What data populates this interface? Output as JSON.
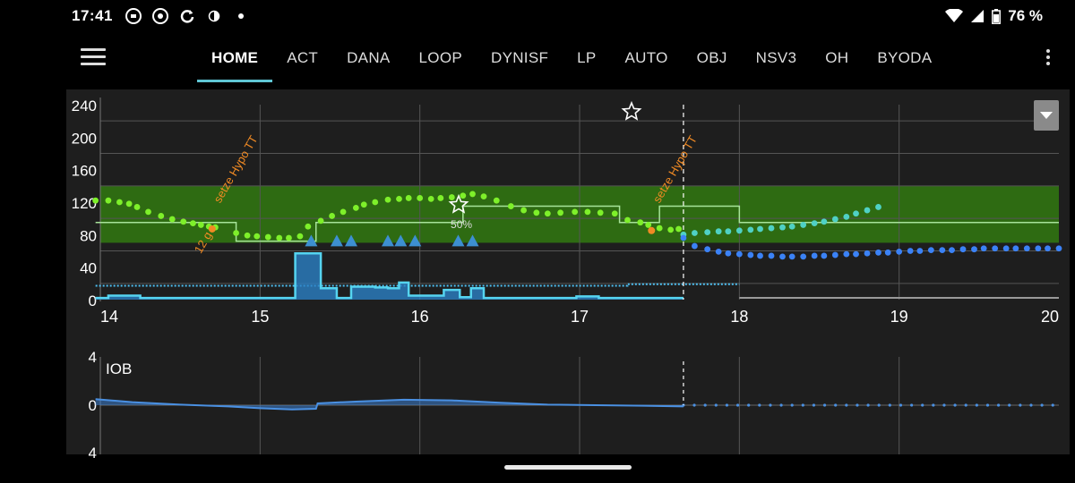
{
  "status": {
    "time": "17:41",
    "battery": "76 %",
    "left_icons": [
      "vpn-key-icon",
      "chrome-icon",
      "sync-icon",
      "contrast-icon",
      "dot-icon"
    ],
    "right_icons": [
      "wifi-icon",
      "signal-icon",
      "battery-icon"
    ]
  },
  "tabs": [
    {
      "label": "HOME",
      "active": true
    },
    {
      "label": "ACT"
    },
    {
      "label": "DANA"
    },
    {
      "label": "LOOP"
    },
    {
      "label": "DYNISF"
    },
    {
      "label": "LP"
    },
    {
      "label": "AUTO"
    },
    {
      "label": "OBJ"
    },
    {
      "label": "NSV3"
    },
    {
      "label": "OH"
    },
    {
      "label": "BYODA"
    }
  ],
  "colors": {
    "target_band": "#2e6b12",
    "bg_in_range": "#7ef02a",
    "bg_predicted": "#4fd1c5",
    "bg_predicted_low": "#3b82f6",
    "basal": "#4fc3f7",
    "smb": "#3d8fd1",
    "carbs": "#f08a24",
    "iob": "#3d7fd1"
  },
  "chart_data": [
    {
      "type": "scatter",
      "name": "bg-graph",
      "x_ticks": [
        "14",
        "15",
        "16",
        "17",
        "18",
        "19",
        "20"
      ],
      "y_ticks": [
        "240",
        "200",
        "160",
        "120",
        "80",
        "40",
        "0"
      ],
      "xlim": [
        14,
        20
      ],
      "ylim": [
        0,
        240
      ],
      "target_range": [
        70,
        140
      ],
      "now": 17.65,
      "annotations": [
        {
          "text": "setze Hypo TT",
          "x": 14.75,
          "y": 118
        },
        {
          "text": "12 g",
          "x": 14.7,
          "y": 80
        },
        {
          "text": "setze Hypo TT",
          "x": 17.5,
          "y": 118
        },
        {
          "text": "50%",
          "x": 16.26,
          "y": 88
        }
      ],
      "bg": {
        "x": [
          13.97,
          14.05,
          14.12,
          14.18,
          14.23,
          14.3,
          14.38,
          14.45,
          14.52,
          14.58,
          14.63,
          14.68,
          14.72,
          14.85,
          14.92,
          14.98,
          15.05,
          15.12,
          15.18,
          15.25,
          15.3,
          15.38,
          15.45,
          15.52,
          15.6,
          15.65,
          15.72,
          15.8,
          15.87,
          15.93,
          16.0,
          16.07,
          16.13,
          16.2,
          16.27,
          16.33,
          16.4,
          16.48,
          16.57,
          16.65,
          16.73,
          16.8,
          16.88,
          16.97,
          17.05,
          17.13,
          17.22,
          17.3,
          17.38,
          17.43,
          17.5,
          17.57,
          17.62
        ],
        "y": [
          122,
          122,
          120,
          118,
          114,
          108,
          103,
          99,
          96,
          94,
          92,
          90,
          89,
          82,
          79,
          78,
          77,
          76,
          76,
          78,
          90,
          97,
          103,
          108,
          113,
          117,
          120,
          123,
          124,
          125,
          125,
          124,
          125,
          126,
          128,
          130,
          127,
          122,
          115,
          110,
          107,
          106,
          107,
          108,
          108,
          107,
          106,
          98,
          95,
          92,
          88,
          86,
          87
        ]
      },
      "predicted": {
        "x": [
          17.65,
          17.72,
          17.8,
          17.87,
          17.93,
          18.0,
          18.07,
          18.13,
          18.2,
          18.27,
          18.33,
          18.4,
          18.47,
          18.53,
          18.6,
          18.67,
          18.73,
          18.8,
          18.87
        ],
        "y": [
          80,
          82,
          83,
          84,
          84,
          85,
          86,
          87,
          88,
          89,
          90,
          92,
          94,
          96,
          99,
          102,
          106,
          110,
          114
        ]
      },
      "predicted_low": {
        "x": [
          17.65,
          17.72,
          17.8,
          17.87,
          17.93,
          18.0,
          18.07,
          18.13,
          18.2,
          18.27,
          18.33,
          18.4,
          18.47,
          18.53,
          18.6,
          18.67,
          18.73,
          18.8,
          18.87,
          18.93,
          19.0,
          19.07,
          19.13,
          19.2,
          19.27,
          19.33,
          19.4,
          19.47,
          19.53,
          19.6,
          19.67,
          19.73,
          19.8,
          19.87,
          19.93,
          20.0
        ],
        "y": [
          76,
          66,
          62,
          59,
          57,
          56,
          55,
          54,
          54,
          53,
          53,
          53,
          54,
          54,
          55,
          56,
          56,
          57,
          58,
          58,
          59,
          60,
          60,
          61,
          61,
          61,
          62,
          62,
          63,
          63,
          63,
          63,
          63,
          63,
          63,
          63
        ]
      },
      "smb_x": [
        15.32,
        15.48,
        15.57,
        15.8,
        15.88,
        15.97,
        16.24,
        16.33
      ],
      "tt_line": {
        "x": [
          13.97,
          14.85,
          14.85,
          15.35,
          15.35,
          16.27,
          16.27,
          17.25,
          17.25,
          17.5,
          17.5,
          18.0,
          18.0,
          20.0
        ],
        "y": [
          95,
          95,
          72,
          72,
          95,
          95,
          115,
          115,
          95,
          95,
          115,
          115,
          95,
          95
        ]
      },
      "basal_rate": {
        "x": [
          13.97,
          14.05,
          14.05,
          14.25,
          14.25,
          15.22,
          15.22,
          15.38,
          15.38,
          15.48,
          15.48,
          15.57,
          15.57,
          15.72,
          15.72,
          15.8,
          15.8,
          15.87,
          15.87,
          15.93,
          15.93,
          16.15,
          16.15,
          16.25,
          16.25,
          16.32,
          16.32,
          16.4,
          16.4,
          16.98,
          16.98,
          17.12,
          17.12,
          17.65
        ],
        "y": [
          2,
          2,
          5,
          5,
          2,
          2,
          57,
          57,
          14,
          14,
          2,
          2,
          16,
          16,
          15,
          15,
          14,
          14,
          21,
          21,
          5,
          5,
          12,
          12,
          3,
          3,
          14,
          14,
          2,
          2,
          4,
          4,
          2,
          2
        ]
      },
      "profile_basal": {
        "x": [
          13.97,
          17.3,
          17.3,
          18.0
        ],
        "y": [
          17,
          17,
          19,
          19
        ]
      }
    },
    {
      "type": "area",
      "name": "iob-graph",
      "label": "IOB",
      "y_ticks": [
        "4",
        "0",
        "4"
      ],
      "ylim": [
        -4,
        4
      ],
      "now": 17.65,
      "iob": {
        "x": [
          13.97,
          14.2,
          14.5,
          14.8,
          15.0,
          15.2,
          15.35,
          15.36,
          15.6,
          15.9,
          16.2,
          16.5,
          16.8,
          17.1,
          17.4,
          17.65
        ],
        "y": [
          0.5,
          0.25,
          0.05,
          -0.1,
          -0.25,
          -0.35,
          -0.3,
          0.15,
          0.3,
          0.45,
          0.4,
          0.2,
          0.05,
          0,
          -0.05,
          -0.1
        ]
      },
      "iob_predicted": {
        "x": [
          17.65,
          20.0
        ],
        "y": [
          -0.05,
          0
        ]
      }
    }
  ]
}
